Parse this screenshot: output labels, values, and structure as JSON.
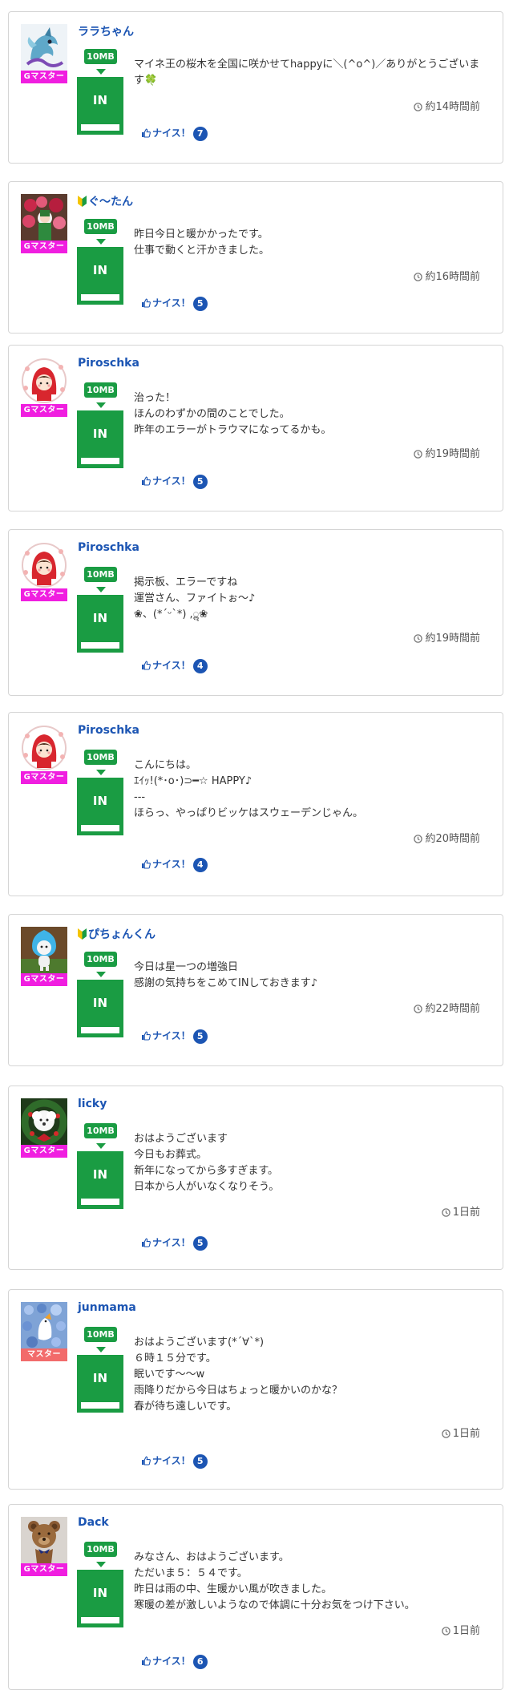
{
  "colors": {
    "username": "#1c55b3",
    "g_master": "#f01ee0",
    "master": "#f26b6b",
    "in_green": "#1a9c43",
    "nice_blue": "#1c55b3"
  },
  "posts": [
    {
      "username": "ララちゃん",
      "beginner": false,
      "rank": "Gマスター",
      "rank_type": "g",
      "capacity": "10MB",
      "status": "IN",
      "message": "マイネ王の桜木を全国に咲かせてhappyに＼(^o^)／ありがとうございます🍀",
      "time": "約14時間前",
      "nice_label": "ナイス！",
      "nice_count": "7",
      "avatar_icon": "dragon-avatar"
    },
    {
      "username": "ぐ〜たん",
      "beginner": true,
      "rank": "Gマスター",
      "rank_type": "g",
      "capacity": "10MB",
      "status": "IN",
      "message": "昨日今日と暖かかったです。\n仕事で動くと汗かきました。",
      "time": "約16時間前",
      "nice_label": "ナイス！",
      "nice_count": "5",
      "avatar_icon": "flowers-avatar"
    },
    {
      "username": "Piroschka",
      "beginner": false,
      "rank": "Gマスター",
      "rank_type": "g",
      "capacity": "10MB",
      "status": "IN",
      "message": "治った！\nほんのわずかの間のことでした。\n昨年のエラーがトラウマになってるかも。",
      "time": "約19時間前",
      "nice_label": "ナイス！",
      "nice_count": "5",
      "avatar_icon": "red-hood-avatar"
    },
    {
      "username": "Piroschka",
      "beginner": false,
      "rank": "Gマスター",
      "rank_type": "g",
      "capacity": "10MB",
      "status": "IN",
      "message": "掲示板、エラーですね\n運営さん、ファイトぉ〜♪\n❀、(*ˊᵕˋ*) ,ॢ❀",
      "time": "約19時間前",
      "nice_label": "ナイス！",
      "nice_count": "4",
      "avatar_icon": "red-hood-avatar"
    },
    {
      "username": "Piroschka",
      "beginner": false,
      "rank": "Gマスター",
      "rank_type": "g",
      "capacity": "10MB",
      "status": "IN",
      "message": "こんにちは。\nｴｲｯ!(*･o･)⊃━☆ HAPPY♪\n---\nほらっ、やっぱりビッケはスウェーデンじゃん。",
      "time": "約20時間前",
      "nice_label": "ナイス！",
      "nice_count": "4",
      "avatar_icon": "red-hood-avatar"
    },
    {
      "username": "ぴちょんくん",
      "beginner": true,
      "rank": "Gマスター",
      "rank_type": "g",
      "capacity": "10MB",
      "status": "IN",
      "message": "今日は星一つの増強日\n感謝の気持ちをこめてINしておきます♪",
      "time": "約22時間前",
      "nice_label": "ナイス！",
      "nice_count": "5",
      "avatar_icon": "mascot-avatar"
    },
    {
      "username": "licky",
      "beginner": false,
      "rank": "Gマスター",
      "rank_type": "g",
      "capacity": "10MB",
      "status": "IN",
      "message": "おはようございます\n今日もお葬式。\n新年になってから多すぎます。\n日本から人がいなくなりそう。",
      "time": "1日前",
      "nice_label": "ナイス！",
      "nice_count": "5",
      "avatar_icon": "dog-wreath-avatar"
    },
    {
      "username": "junmama",
      "beginner": false,
      "rank": "マスター",
      "rank_type": "m",
      "capacity": "10MB",
      "status": "IN",
      "message": "おはようございます(*´∀`*)\n６時１５分です。\n眠いです〜〜w\n雨降りだから今日はちょっと暖かいのかな？\n春が待ち遠しいです。",
      "time": "1日前",
      "nice_label": "ナイス！",
      "nice_count": "5",
      "avatar_icon": "blue-flowers-avatar"
    },
    {
      "username": "Dack",
      "beginner": false,
      "rank": "Gマスター",
      "rank_type": "g",
      "capacity": "10MB",
      "status": "IN",
      "message": "みなさん、おはようございます。\nただいま５：５４です。\n昨日は雨の中、生暖かい風が吹きました。\n寒暖の差が激しいようなので体調に十分お気をつけ下さい。",
      "time": "1日前",
      "nice_label": "ナイス！",
      "nice_count": "6",
      "avatar_icon": "teddy-bear-avatar"
    }
  ]
}
